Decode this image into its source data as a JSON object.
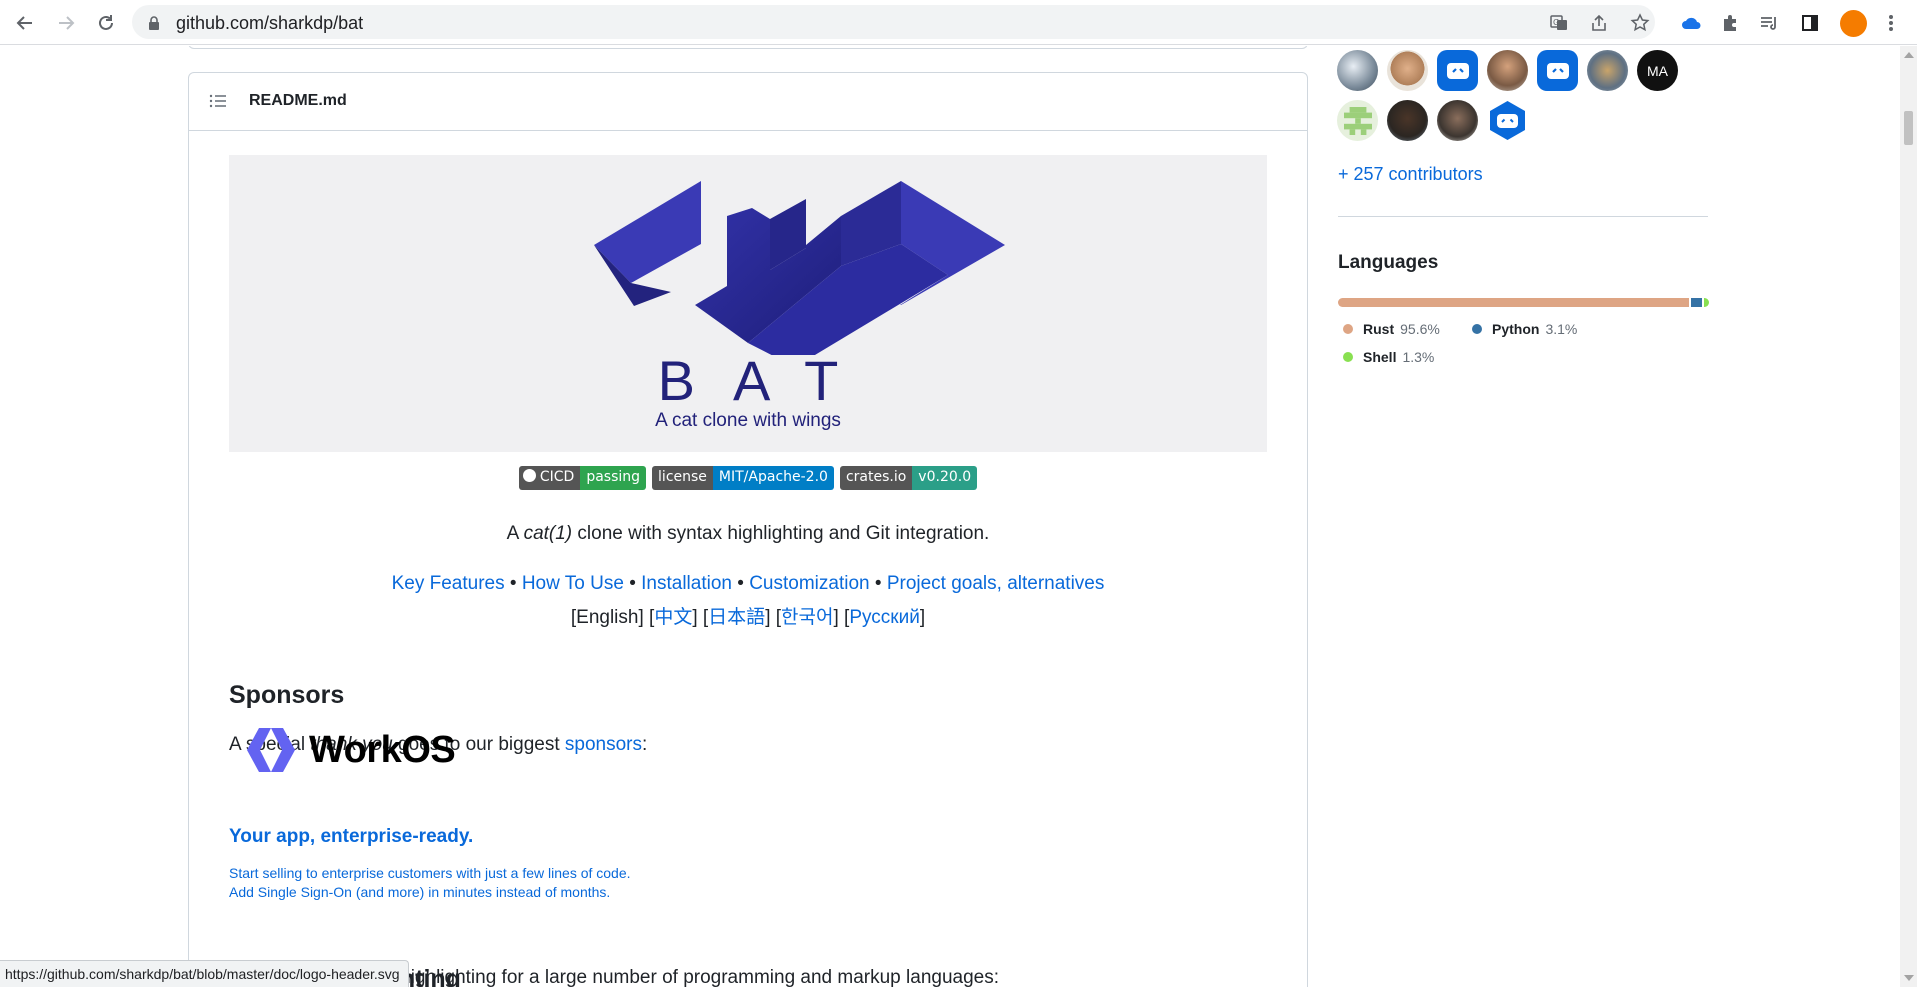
{
  "browser": {
    "url": "github.com/sharkdp/bat",
    "status_url": "https://github.com/sharkdp/bat/blob/master/doc/logo-header.svg"
  },
  "readme": {
    "filename": "README.md",
    "logo_word": "BAT",
    "logo_tagline": "A cat clone with wings",
    "badges": [
      {
        "label": "CICD",
        "value": "passing",
        "color": "#2ea44f"
      },
      {
        "label": "license",
        "value": "MIT/Apache-2.0",
        "color": "#007ec6"
      },
      {
        "label": "crates.io",
        "value": "v0.20.0",
        "color": "#2b9f88"
      }
    ],
    "tagline_pre": "A ",
    "tagline_em": "cat(1)",
    "tagline_post": " clone with syntax highlighting and Git integration.",
    "nav_links": [
      "Key Features",
      "How To Use",
      "Installation",
      "Customization",
      "Project goals, alternatives"
    ],
    "nav_sep": " • ",
    "languages_current": "[English]",
    "language_links": [
      "中文",
      "日本語",
      "한국어",
      "Русский"
    ],
    "sponsors_heading": "Sponsors",
    "sponsors_pre": "A special ",
    "sponsors_em": "thank you",
    "sponsors_mid": " goes to our biggest ",
    "sponsors_link": "sponsors",
    "sponsors_post": ":",
    "workos_name": "WorkOS",
    "workos_heading": "Your app, enterprise-ready.",
    "workos_line1": "Start selling to enterprise customers with just a few lines of code.",
    "workos_line2": "Add Single Sign-On (and more) in minutes instead of months.",
    "syntax_heading": "Syntax highlighting",
    "cutoff_text": "Bat supports syntax highlighting for a large number of programming and markup languages:"
  },
  "sidebar": {
    "avatar_ma": "MA",
    "contributors_link": "+ 257 contributors",
    "languages_title": "Languages",
    "languages": [
      {
        "name": "Rust",
        "percent": "95.6%",
        "color": "#dea584",
        "share": 95.6
      },
      {
        "name": "Python",
        "percent": "3.1%",
        "color": "#3572a5",
        "share": 3.1
      },
      {
        "name": "Shell",
        "percent": "1.3%",
        "color": "#89e051",
        "share": 1.3
      }
    ]
  }
}
